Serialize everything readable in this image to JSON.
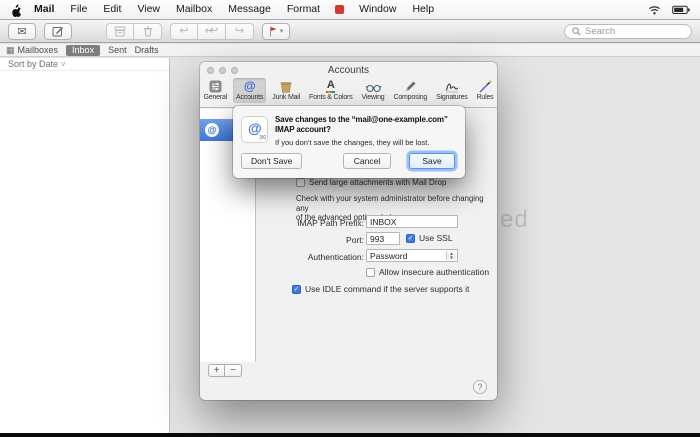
{
  "menu_bar": {
    "items": [
      "Mail",
      "File",
      "Edit",
      "View",
      "Mailbox",
      "Message",
      "Format",
      "Window",
      "Help"
    ]
  },
  "toolbar": {
    "search_placeholder": "Search"
  },
  "favorites_bar": {
    "mailboxes_label": "Mailboxes",
    "tabs": [
      "Inbox",
      "Sent",
      "Drafts"
    ],
    "selected_tab": "Inbox"
  },
  "message_list": {
    "sort_label": "Sort by Date"
  },
  "background": {
    "watermark": "ed"
  },
  "preferences": {
    "window_title": "Accounts",
    "toolbar_items": [
      "General",
      "Accounts",
      "Junk Mail",
      "Fonts & Colors",
      "Viewing",
      "Composing",
      "Signatures",
      "Rules"
    ],
    "selected_item": "Accounts",
    "form": {
      "mail_drop_label": "Send large attachments with Mail Drop",
      "mail_drop_checked": false,
      "admin_note_lines": [
        "Check with your system administrator before changing any",
        "of the advanced options below:"
      ],
      "imap_path_label": "IMAP Path Prefix:",
      "imap_path_value": "INBOX",
      "port_label": "Port:",
      "port_value": "993",
      "use_ssl_label": "Use SSL",
      "use_ssl_checked": true,
      "auth_label": "Authentication:",
      "auth_value": "Password",
      "insecure_label": "Allow insecure authentication",
      "insecure_checked": false,
      "idle_label": "Use IDLE command if the server supports it",
      "idle_checked": true
    },
    "add_label": "+",
    "remove_label": "−",
    "help_label": "?"
  },
  "dialog": {
    "title": "Save changes to the “mail@one-example.com” IMAP account?",
    "message": "If you don't save the changes, they will be lost.",
    "buttons": {
      "dont_save": "Don't Save",
      "cancel": "Cancel",
      "save": "Save"
    }
  },
  "glyphs": {
    "at": "@",
    "envelope": "✉",
    "reply": "↩",
    "forward": "↪",
    "chevron_down": "▾",
    "grid": "▦",
    "sort_chevron": "˅",
    "check": "✓",
    "fonts_letter": "A",
    "stepper_up": "▲",
    "stepper_down": "▼"
  },
  "colors": {
    "accent": "#3c7ce0",
    "selection_gradient_top": "#6fa3ec",
    "selection_gradient_bottom": "#3f77dd",
    "flag_red": "#d2392c"
  }
}
